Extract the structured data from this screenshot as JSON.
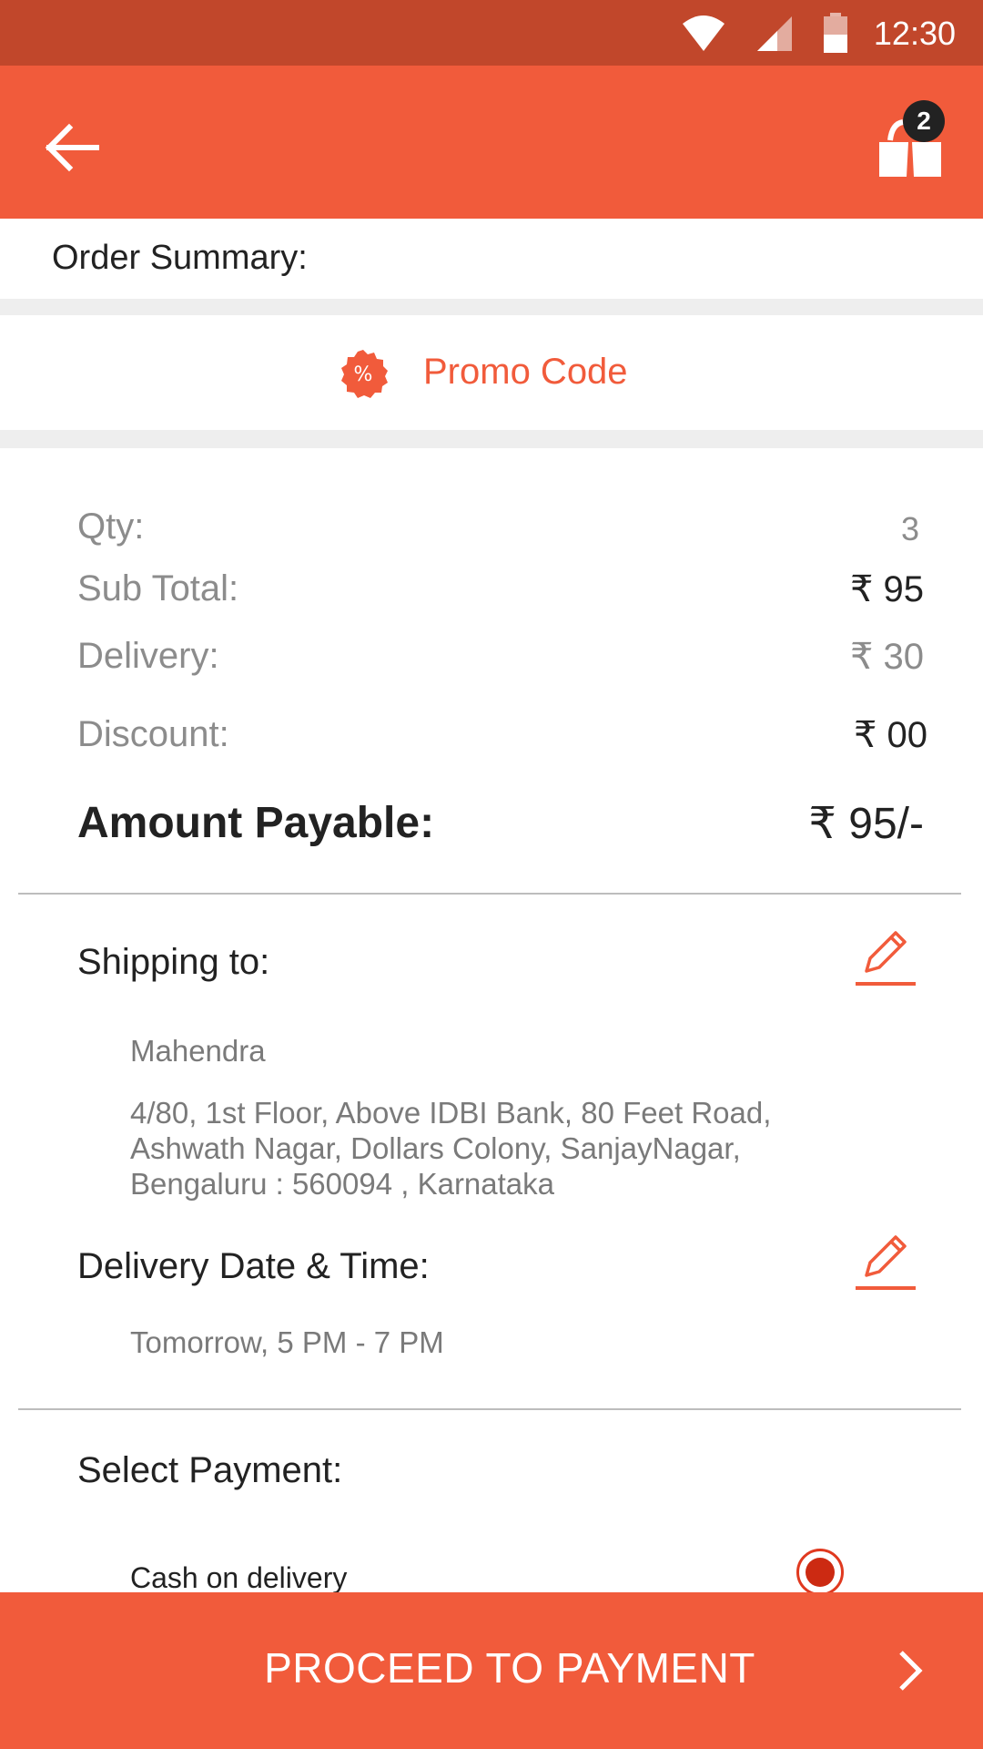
{
  "status_bar": {
    "time": "12:30",
    "icons": [
      "wifi-icon",
      "signal-icon",
      "battery-icon"
    ]
  },
  "app_bar": {
    "back_icon": "arrow-left-icon",
    "cart_icon": "shopping-bag-icon",
    "cart_count": "2"
  },
  "order_summary": {
    "title": "Order Summary:"
  },
  "promo": {
    "icon": "percent-badge-icon",
    "label": "Promo Code"
  },
  "totals": {
    "qty_label": "Qty:",
    "qty_value": "3",
    "subtotal_label": "Sub Total:",
    "subtotal_value": "₹ 95",
    "delivery_label": "Delivery:",
    "delivery_value": "₹ 30",
    "discount_label": "Discount:",
    "discount_value": "₹ 00",
    "payable_label": "Amount Payable:",
    "payable_value": "₹ 95/-"
  },
  "shipping": {
    "heading": "Shipping to:",
    "name": "Mahendra",
    "address_line1": "4/80, 1st Floor, Above IDBI Bank, 80 Feet Road,",
    "address_line2": "Ashwath Nagar, Dollars Colony, SanjayNagar,",
    "address_line3": "Bengaluru : 560094 , Karnataka"
  },
  "delivery": {
    "heading": "Delivery Date & Time:",
    "slot": "Tomorrow, 5 PM - 7 PM"
  },
  "payment": {
    "heading": "Select Payment:",
    "option_label": "Cash on delivery",
    "option_selected": true
  },
  "footer": {
    "proceed_label": "PROCEED TO PAYMENT"
  },
  "colors": {
    "accent": "#f15b3b",
    "status_bar": "#c1472b",
    "muted_text": "#8c8c8c",
    "selected_radio": "#cc2a12"
  }
}
